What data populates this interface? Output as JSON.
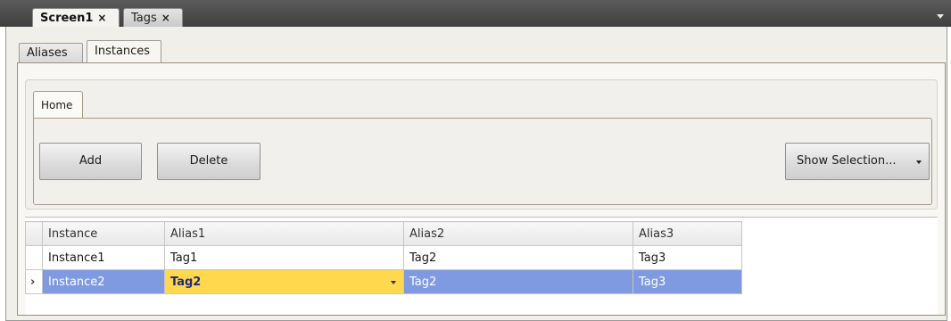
{
  "doc_tabs": [
    {
      "label": "Screen1",
      "close": "×"
    },
    {
      "label": "Tags",
      "close": "×"
    }
  ],
  "sub_tabs": [
    {
      "label": "Aliases"
    },
    {
      "label": "Instances"
    }
  ],
  "ribbon": {
    "tab_label": "Home",
    "add_label": "Add",
    "delete_label": "Delete",
    "show_selection_label": "Show Selection..."
  },
  "grid": {
    "columns": [
      "Instance",
      "Alias1",
      "Alias2",
      "Alias3"
    ],
    "rows": [
      {
        "instance": "Instance1",
        "alias1": "Tag1",
        "alias2": "Tag2",
        "alias3": "Tag3"
      },
      {
        "instance": "Instance2",
        "alias1": "Tag2",
        "alias2": "Tag2",
        "alias3": "Tag3"
      }
    ],
    "row_indicator": "›"
  },
  "colors": {
    "selection": "#7f9ae0",
    "editing_cell": "#ffd84d",
    "tabbar": "#4a4a4a"
  }
}
